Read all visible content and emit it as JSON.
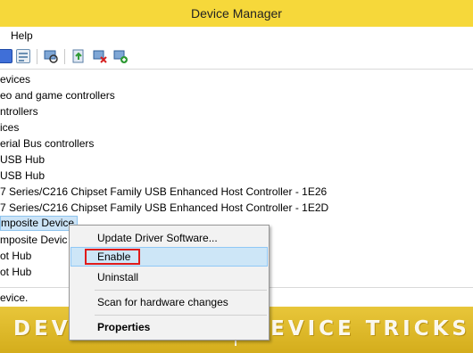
{
  "window": {
    "title": "Device Manager"
  },
  "menu": {
    "help": "Help"
  },
  "toolbar": {
    "icons": [
      "help-icon",
      "properties-view-icon",
      "scan-hardware-icon",
      "update-driver-icon",
      "uninstall-device-icon",
      "enable-device-icon"
    ]
  },
  "tree": {
    "items": [
      "evices",
      "eo and game controllers",
      "ntrollers",
      "ices",
      "erial Bus controllers",
      " USB Hub",
      " USB Hub",
      "7 Series/C216 Chipset Family USB Enhanced Host Controller - 1E26",
      "7 Series/C216 Chipset Family USB Enhanced Host Controller - 1E2D",
      "mposite Device",
      "mposite Devic",
      "ot Hub",
      "ot Hub"
    ]
  },
  "status": {
    "text": "evice."
  },
  "context_menu": {
    "items": [
      "Update Driver Software...",
      "Enable",
      "Uninstall",
      "Scan for hardware changes",
      "Properties"
    ]
  },
  "watermark": {
    "left": "DEVICE TRICKS",
    "right": "DEVICE TRICKS"
  },
  "colors": {
    "title_bar": "#f6d83a",
    "banner": "#dfb92a",
    "highlight_box": "#e01b1b",
    "selection": "#cce4f7"
  }
}
